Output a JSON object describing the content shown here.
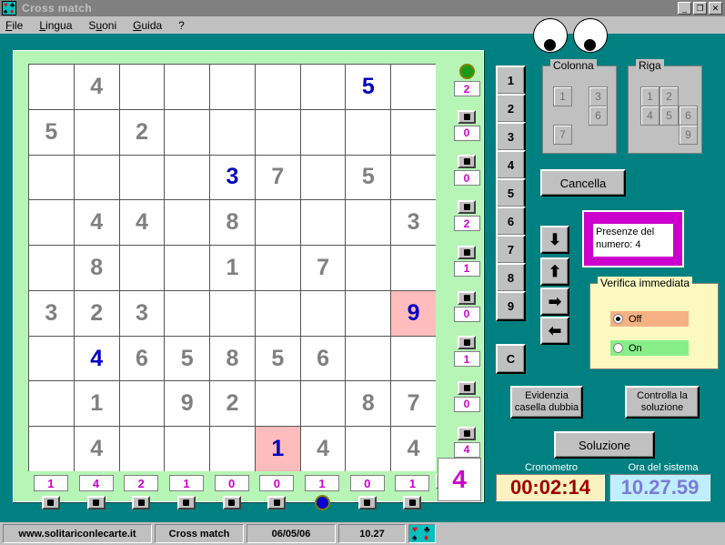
{
  "window": {
    "title": "Cross match",
    "icon": "cards-suits-icon",
    "buttons": {
      "minimize": "_",
      "maximize": "❐",
      "close": "✕"
    }
  },
  "menu": {
    "items": [
      {
        "label": "File",
        "name": "menu-file"
      },
      {
        "label": "Lingua",
        "name": "menu-lingua"
      },
      {
        "label": "Suoni",
        "name": "menu-suoni"
      },
      {
        "label": "Guida",
        "name": "menu-guida"
      },
      {
        "label": "?",
        "name": "menu-help"
      }
    ]
  },
  "grid": {
    "rows": [
      [
        {
          "v": "",
          "t": "e"
        },
        {
          "v": "4",
          "t": "f"
        },
        {
          "v": "",
          "t": "e"
        },
        {
          "v": "",
          "t": "e"
        },
        {
          "v": "",
          "t": "e"
        },
        {
          "v": "",
          "t": "e"
        },
        {
          "v": "",
          "t": "e"
        },
        {
          "v": "5",
          "t": "u"
        },
        {
          "v": "",
          "t": "e"
        }
      ],
      [
        {
          "v": "5",
          "t": "f"
        },
        {
          "v": "",
          "t": "e"
        },
        {
          "v": "2",
          "t": "f"
        },
        {
          "v": "",
          "t": "e"
        },
        {
          "v": "",
          "t": "e"
        },
        {
          "v": "",
          "t": "e"
        },
        {
          "v": "",
          "t": "e"
        },
        {
          "v": "",
          "t": "e"
        },
        {
          "v": "",
          "t": "e"
        }
      ],
      [
        {
          "v": "",
          "t": "e"
        },
        {
          "v": "",
          "t": "e"
        },
        {
          "v": "",
          "t": "e"
        },
        {
          "v": "",
          "t": "e"
        },
        {
          "v": "3",
          "t": "u"
        },
        {
          "v": "7",
          "t": "f"
        },
        {
          "v": "",
          "t": "e"
        },
        {
          "v": "5",
          "t": "f"
        },
        {
          "v": "",
          "t": "e"
        }
      ],
      [
        {
          "v": "",
          "t": "e"
        },
        {
          "v": "4",
          "t": "f"
        },
        {
          "v": "4",
          "t": "f"
        },
        {
          "v": "",
          "t": "e"
        },
        {
          "v": "8",
          "t": "f"
        },
        {
          "v": "",
          "t": "e"
        },
        {
          "v": "",
          "t": "e"
        },
        {
          "v": "",
          "t": "e"
        },
        {
          "v": "3",
          "t": "f"
        }
      ],
      [
        {
          "v": "",
          "t": "e"
        },
        {
          "v": "8",
          "t": "f"
        },
        {
          "v": "",
          "t": "e"
        },
        {
          "v": "",
          "t": "e"
        },
        {
          "v": "1",
          "t": "f"
        },
        {
          "v": "",
          "t": "e"
        },
        {
          "v": "7",
          "t": "f"
        },
        {
          "v": "",
          "t": "e"
        },
        {
          "v": "",
          "t": "e"
        }
      ],
      [
        {
          "v": "3",
          "t": "f"
        },
        {
          "v": "2",
          "t": "f"
        },
        {
          "v": "3",
          "t": "f"
        },
        {
          "v": "",
          "t": "e"
        },
        {
          "v": "",
          "t": "e"
        },
        {
          "v": "",
          "t": "e"
        },
        {
          "v": "",
          "t": "e"
        },
        {
          "v": "",
          "t": "e"
        },
        {
          "v": "9",
          "t": "uf"
        }
      ],
      [
        {
          "v": "",
          "t": "e"
        },
        {
          "v": "4",
          "t": "u"
        },
        {
          "v": "6",
          "t": "f"
        },
        {
          "v": "5",
          "t": "f"
        },
        {
          "v": "8",
          "t": "f"
        },
        {
          "v": "5",
          "t": "f"
        },
        {
          "v": "6",
          "t": "f"
        },
        {
          "v": "",
          "t": "e"
        },
        {
          "v": "",
          "t": "e"
        }
      ],
      [
        {
          "v": "",
          "t": "e"
        },
        {
          "v": "1",
          "t": "f"
        },
        {
          "v": "",
          "t": "e"
        },
        {
          "v": "9",
          "t": "f"
        },
        {
          "v": "2",
          "t": "f"
        },
        {
          "v": "",
          "t": "e"
        },
        {
          "v": "",
          "t": "e"
        },
        {
          "v": "8",
          "t": "f"
        },
        {
          "v": "7",
          "t": "f"
        }
      ],
      [
        {
          "v": "",
          "t": "e"
        },
        {
          "v": "4",
          "t": "f"
        },
        {
          "v": "",
          "t": "e"
        },
        {
          "v": "",
          "t": "e"
        },
        {
          "v": "",
          "t": "e"
        },
        {
          "v": "1",
          "t": "uf"
        },
        {
          "v": "4",
          "t": "f"
        },
        {
          "v": "",
          "t": "e"
        },
        {
          "v": "4",
          "t": "f"
        }
      ]
    ]
  },
  "row_indicators": {
    "counts": [
      "2",
      "0",
      "0",
      "2",
      "1",
      "0",
      "1",
      "0",
      "4"
    ],
    "active_index": 0
  },
  "col_indicators": {
    "counts": [
      "1",
      "4",
      "2",
      "1",
      "0",
      "0",
      "1",
      "0",
      "1"
    ],
    "active_index": 6
  },
  "selected_number": "4",
  "close_grid_button": "x",
  "numpad": {
    "numbers": [
      "1",
      "2",
      "3",
      "4",
      "5",
      "6",
      "7",
      "8",
      "9"
    ],
    "clear_label": "C"
  },
  "colonna": {
    "title": "Colonna",
    "values": [
      {
        "label": "1",
        "x": 11,
        "y": 22
      },
      {
        "label": "3",
        "x": 50,
        "y": 22
      },
      {
        "label": "6",
        "x": 50,
        "y": 43
      },
      {
        "label": "7",
        "x": 11,
        "y": 64
      }
    ]
  },
  "riga": {
    "title": "Riga",
    "values": [
      {
        "label": "1",
        "x": 13,
        "y": 22
      },
      {
        "label": "2",
        "x": 34,
        "y": 22
      },
      {
        "label": "4",
        "x": 13,
        "y": 43
      },
      {
        "label": "5",
        "x": 34,
        "y": 43
      },
      {
        "label": "6",
        "x": 55,
        "y": 43
      },
      {
        "label": "9",
        "x": 55,
        "y": 64
      }
    ]
  },
  "buttons": {
    "cancella": "Cancella",
    "arrow_down": "⬇",
    "arrow_up": "⬆",
    "arrow_right": "➡",
    "arrow_left": "⬅",
    "evidenzia_line1": "Evidenzia",
    "evidenzia_line2": "casella dubbia",
    "controlla_line1": "Controlla la",
    "controlla_line2": "soluzione",
    "soluzione": "Soluzione"
  },
  "presenze": {
    "line1": "Presenze del",
    "line2": "numero: 4"
  },
  "verifica": {
    "title": "Verifica immediata",
    "off_label": "Off",
    "on_label": "On",
    "selected": "Off"
  },
  "timers": {
    "cronometro_label": "Cronometro",
    "cronometro_value": "00:02:14",
    "sistema_label": "Ora del sistema",
    "sistema_value": "10.27.59"
  },
  "statusbar": {
    "website": "www.solitariconlecarte.it",
    "game": "Cross match",
    "date": "06/05/06",
    "time": "10.27",
    "icon": "cards-suits-icon"
  },
  "colors": {
    "teal_bg": "#008080",
    "board_green": "#b6f5b6",
    "fixed_number": "#808080",
    "user_number": "#0000c0",
    "flag_cell": "#ffbcbc",
    "magenta": "#cc00cc",
    "chrome": "#c0c0c0"
  }
}
